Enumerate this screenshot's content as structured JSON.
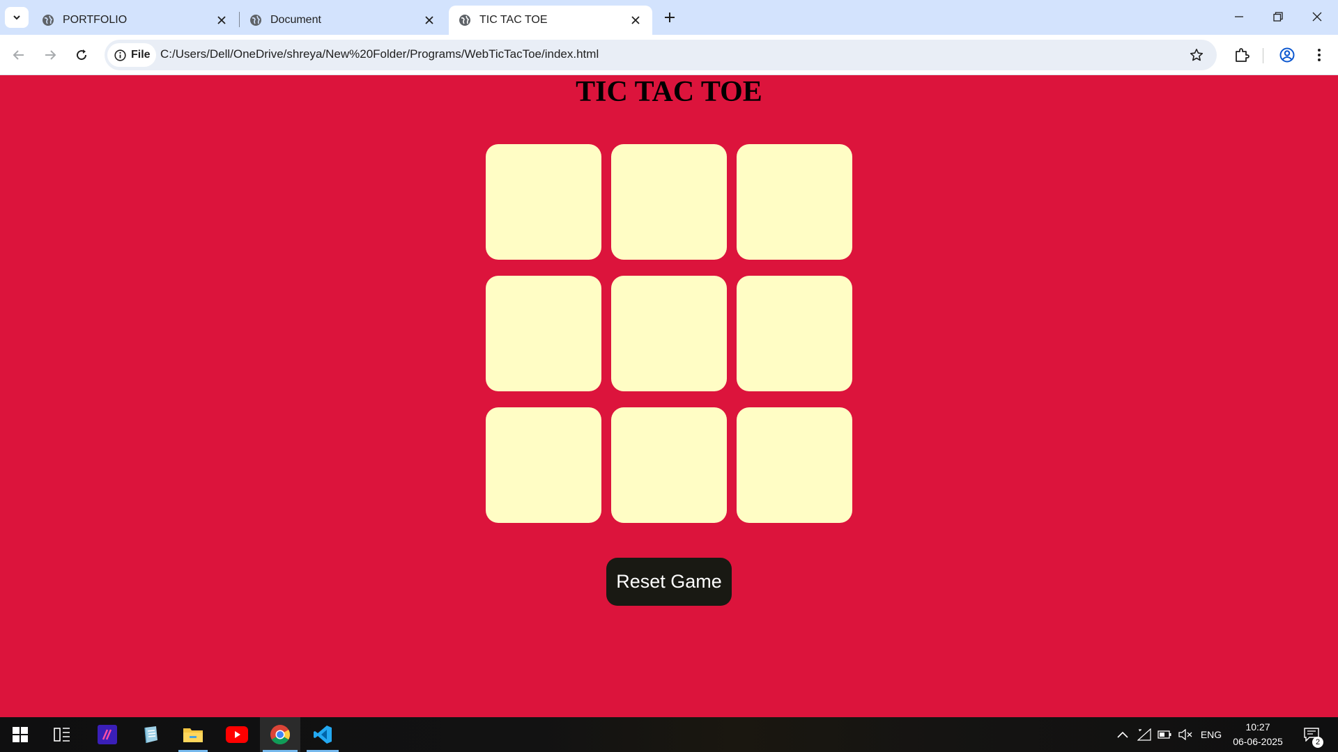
{
  "browser": {
    "tabs": [
      {
        "title": "PORTFOLIO",
        "icon": "globe-icon",
        "active": false
      },
      {
        "title": "Document",
        "icon": "globe-icon",
        "active": false
      },
      {
        "title": "TIC TAC TOE",
        "icon": "globe-icon",
        "active": true
      }
    ],
    "address_bar": {
      "scheme_chip": "File",
      "url": "C:/Users/Dell/OneDrive/shreya/New%20Folder/Programs/WebTicTacToe/index.html"
    }
  },
  "page": {
    "heading": "TIC TAC TOE",
    "board": {
      "cells": [
        "",
        "",
        "",
        "",
        "",
        "",
        "",
        "",
        ""
      ]
    },
    "reset_button": "Reset Game",
    "colors": {
      "background": "#dc143c",
      "cell": "#fffdc5",
      "button": "#191913"
    }
  },
  "taskbar": {
    "apps": [
      "start-icon",
      "task-view-icon",
      "app-icon",
      "notepad-icon",
      "file-explorer-icon",
      "youtube-icon",
      "chrome-icon",
      "vscode-icon"
    ],
    "tray": {
      "language": "ENG",
      "time": "10:27",
      "date": "06-06-2025",
      "notification_count": "2"
    }
  }
}
